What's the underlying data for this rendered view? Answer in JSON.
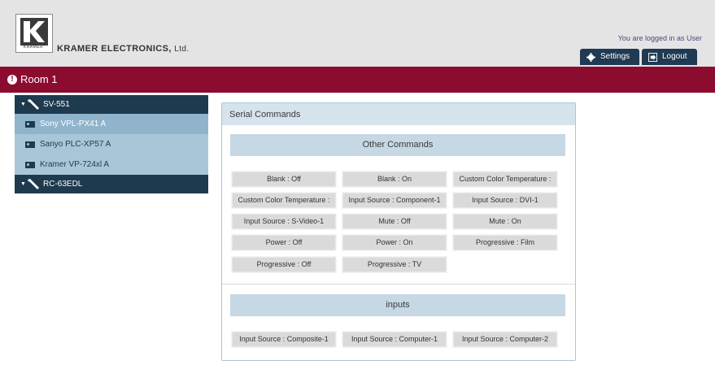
{
  "header": {
    "company": "KRAMER ELECTRONICS,",
    "company_suffix": "Ltd.",
    "logo_text": "KRAMER",
    "logged_in": "You are logged in as User",
    "settings_label": "Settings",
    "logout_label": "Logout"
  },
  "room": {
    "title": "Room 1"
  },
  "sidebar": {
    "groups": [
      {
        "label": "SV-551",
        "items": [
          {
            "label": "Sony VPL-PX41 A"
          },
          {
            "label": "Sanyo PLC-XP57 A"
          },
          {
            "label": "Kramer VP-724xl A"
          }
        ]
      },
      {
        "label": "RC-63EDL"
      }
    ]
  },
  "panel": {
    "title": "Serial Commands",
    "other": {
      "title": "Other Commands",
      "buttons": [
        "Blank : Off",
        "Blank : On",
        "Custom Color Temperature :",
        "Custom Color Temperature :",
        "Input Source : Component-1",
        "Input Source : DVI-1",
        "Input Source : S-Video-1",
        "Mute : Off",
        "Mute : On",
        "Power : Off",
        "Power : On",
        "Progressive : Film",
        "Progressive : Off",
        "Progressive : TV"
      ]
    },
    "inputs": {
      "title": "inputs",
      "buttons": [
        "Input Source : Composite-1",
        "Input Source : Computer-1",
        "Input Source : Computer-2"
      ]
    }
  },
  "colors": {
    "header_bg": "#e4e4e4",
    "room_bar": "#8c0c2f",
    "sidebar_dark": "#1e3a4e",
    "sidebar_light": "#a9c6d8",
    "panel_accent": "#c5d8e4"
  }
}
